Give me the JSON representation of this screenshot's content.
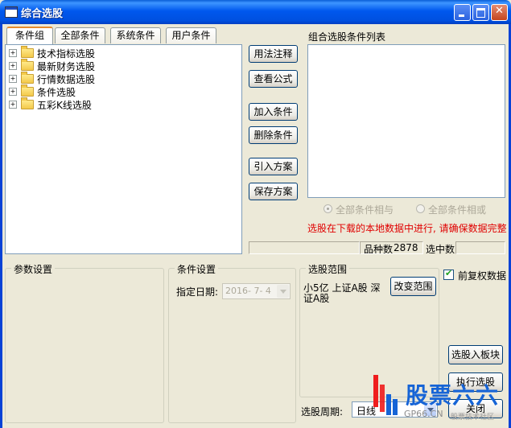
{
  "window": {
    "title": "综合选股"
  },
  "tabs": [
    "条件组",
    "全部条件",
    "系统条件",
    "用户条件"
  ],
  "tree": [
    "技术指标选股",
    "最新财务选股",
    "行情数据选股",
    "条件选股",
    "五彩K线选股"
  ],
  "mid_buttons": {
    "usage": "用法注释",
    "formula": "查看公式",
    "add": "加入条件",
    "delete": "删除条件",
    "import": "引入方案",
    "save": "保存方案"
  },
  "condition_list": {
    "label": "组合选股条件列表"
  },
  "logic": {
    "and_label": "全部条件相与",
    "or_label": "全部条件相或"
  },
  "notice": "选股在下载的本地数据中进行, 请确保数据完整",
  "stats": {
    "stock_count_label": "品种数",
    "stock_count": "2878",
    "selected_label": "选中数",
    "selected_count": ""
  },
  "params": {
    "label": "参数设置"
  },
  "cond_settings": {
    "label": "条件设置",
    "date_label": "指定日期:",
    "date_value": "2016- 7- 4"
  },
  "range": {
    "label": "选股范围",
    "line1": "小5亿 上证A股 深",
    "line2": "证A股",
    "change_button": "改变范围"
  },
  "restored": {
    "label": "前复权数据",
    "checked": true
  },
  "actions": {
    "to_block": "选股入板块",
    "execute": "执行选股",
    "close": "关闭"
  },
  "period": {
    "label": "选股周期:",
    "value": "日线"
  },
  "watermark": {
    "brand": "股票六六",
    "url_text": "GP66.CN",
    "tagline": "股票技术社区"
  }
}
